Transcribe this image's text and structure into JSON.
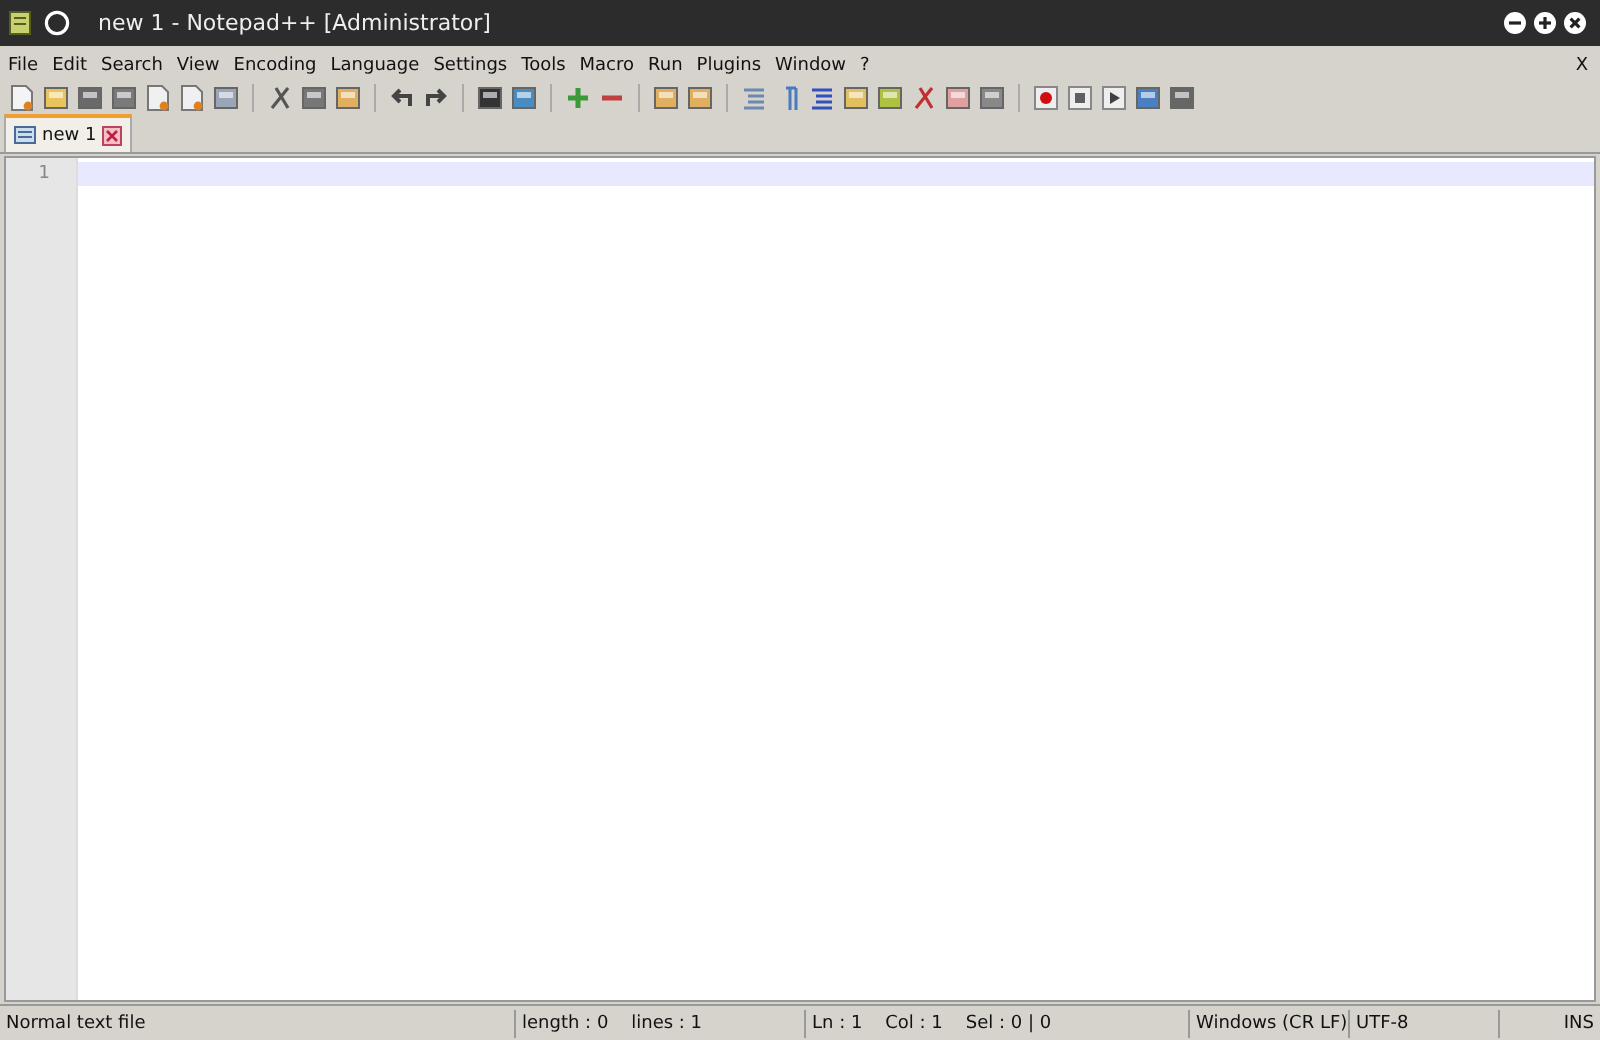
{
  "window": {
    "title": "new 1 - Notepad++ [Administrator]"
  },
  "menu": [
    {
      "label": "File"
    },
    {
      "label": "Edit"
    },
    {
      "label": "Search"
    },
    {
      "label": "View"
    },
    {
      "label": "Encoding"
    },
    {
      "label": "Language"
    },
    {
      "label": "Settings"
    },
    {
      "label": "Tools"
    },
    {
      "label": "Macro"
    },
    {
      "label": "Run"
    },
    {
      "label": "Plugins"
    },
    {
      "label": "Window"
    },
    {
      "label": "?"
    }
  ],
  "menu_close": "X",
  "tabs": [
    {
      "label": "new 1",
      "selected": true
    }
  ],
  "editor": {
    "line_numbers": [
      "1"
    ]
  },
  "status_bar": {
    "file_type": "Normal text file",
    "length": "length : 0    lines : 1",
    "position": "Ln : 1    Col : 1    Sel : 0 | 0",
    "eol": "Windows (CR LF)",
    "encoding": "UTF-8",
    "mode": "INS"
  }
}
